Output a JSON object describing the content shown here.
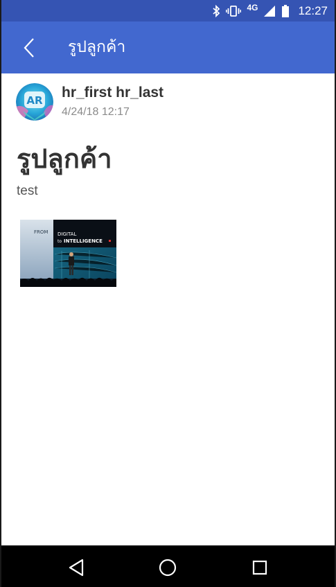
{
  "status_bar": {
    "time": "12:27",
    "network": "4G",
    "icons": [
      "bluetooth-icon",
      "vibrate-icon",
      "signal-icon",
      "battery-icon"
    ]
  },
  "app_bar": {
    "title": "รูปลูกค้า",
    "back_icon": "chevron-left-icon",
    "color": "#4268cf"
  },
  "post": {
    "author": "hr_first hr_last",
    "timestamp": "4/24/18 12:17",
    "avatar_text": "AR",
    "title": "รูปลูกค้า",
    "body": "test",
    "photo": {
      "text_from": "FROM",
      "text_digital": "DIGITAL",
      "text_to": "to",
      "text_intelligence": "INTELLIGENCE"
    }
  },
  "nav_bar": {
    "buttons": [
      "back-triangle-icon",
      "home-circle-icon",
      "recents-square-icon"
    ]
  }
}
